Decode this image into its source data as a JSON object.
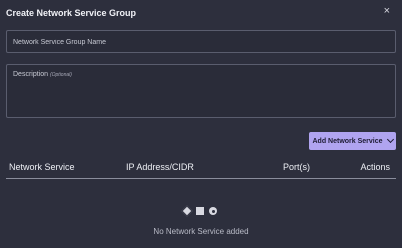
{
  "dialog": {
    "title": "Create Network Service Group",
    "close_icon": "×"
  },
  "name_field": {
    "placeholder": "Network Service Group Name",
    "value": ""
  },
  "description_field": {
    "label": "Description",
    "optional": "(Optional)",
    "value": ""
  },
  "add_button": {
    "label": "Add Network Service",
    "icon": "chevron-down-icon",
    "color": "#b0a4f0"
  },
  "table": {
    "columns": [
      "Network Service",
      "IP Address/CIDR",
      "Port(s)",
      "Actions"
    ],
    "rows": []
  },
  "empty_state": {
    "icons": [
      "diamond-icon",
      "square-icon",
      "circle-icon"
    ],
    "text": "No Network Service added"
  },
  "colors": {
    "background": "#2d2f3d",
    "accent": "#b0a4f0"
  }
}
